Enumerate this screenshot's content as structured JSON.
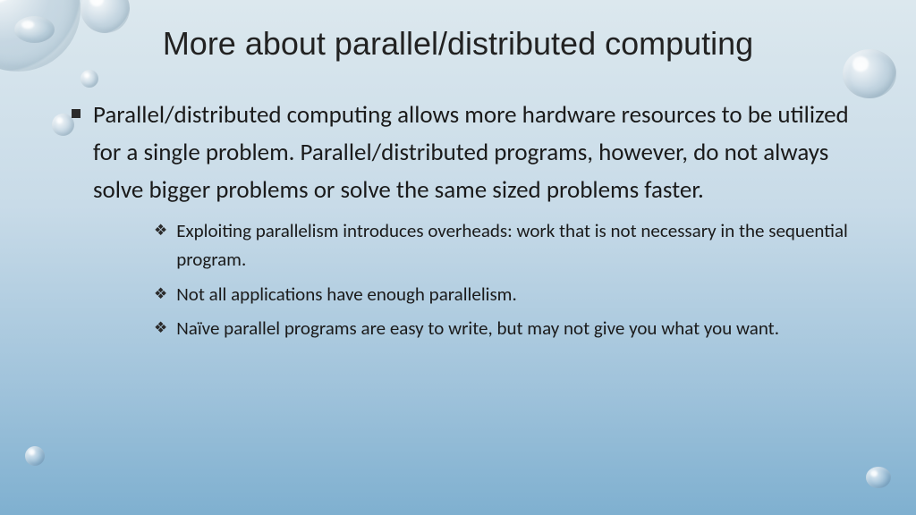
{
  "title": "More about parallel/distributed computing",
  "main": {
    "text": "Parallel/distributed computing allows more hardware resources to be utilized for a single problem. Parallel/distributed programs, however, do not always solve bigger problems or solve the same sized problems faster."
  },
  "subs": [
    {
      "text": "Exploiting parallelism introduces overheads: work that is not necessary in the sequential program."
    },
    {
      "text": "Not all applications have enough parallelism."
    },
    {
      "text": "Naïve parallel programs are easy to write, but may not give you what you want."
    }
  ]
}
